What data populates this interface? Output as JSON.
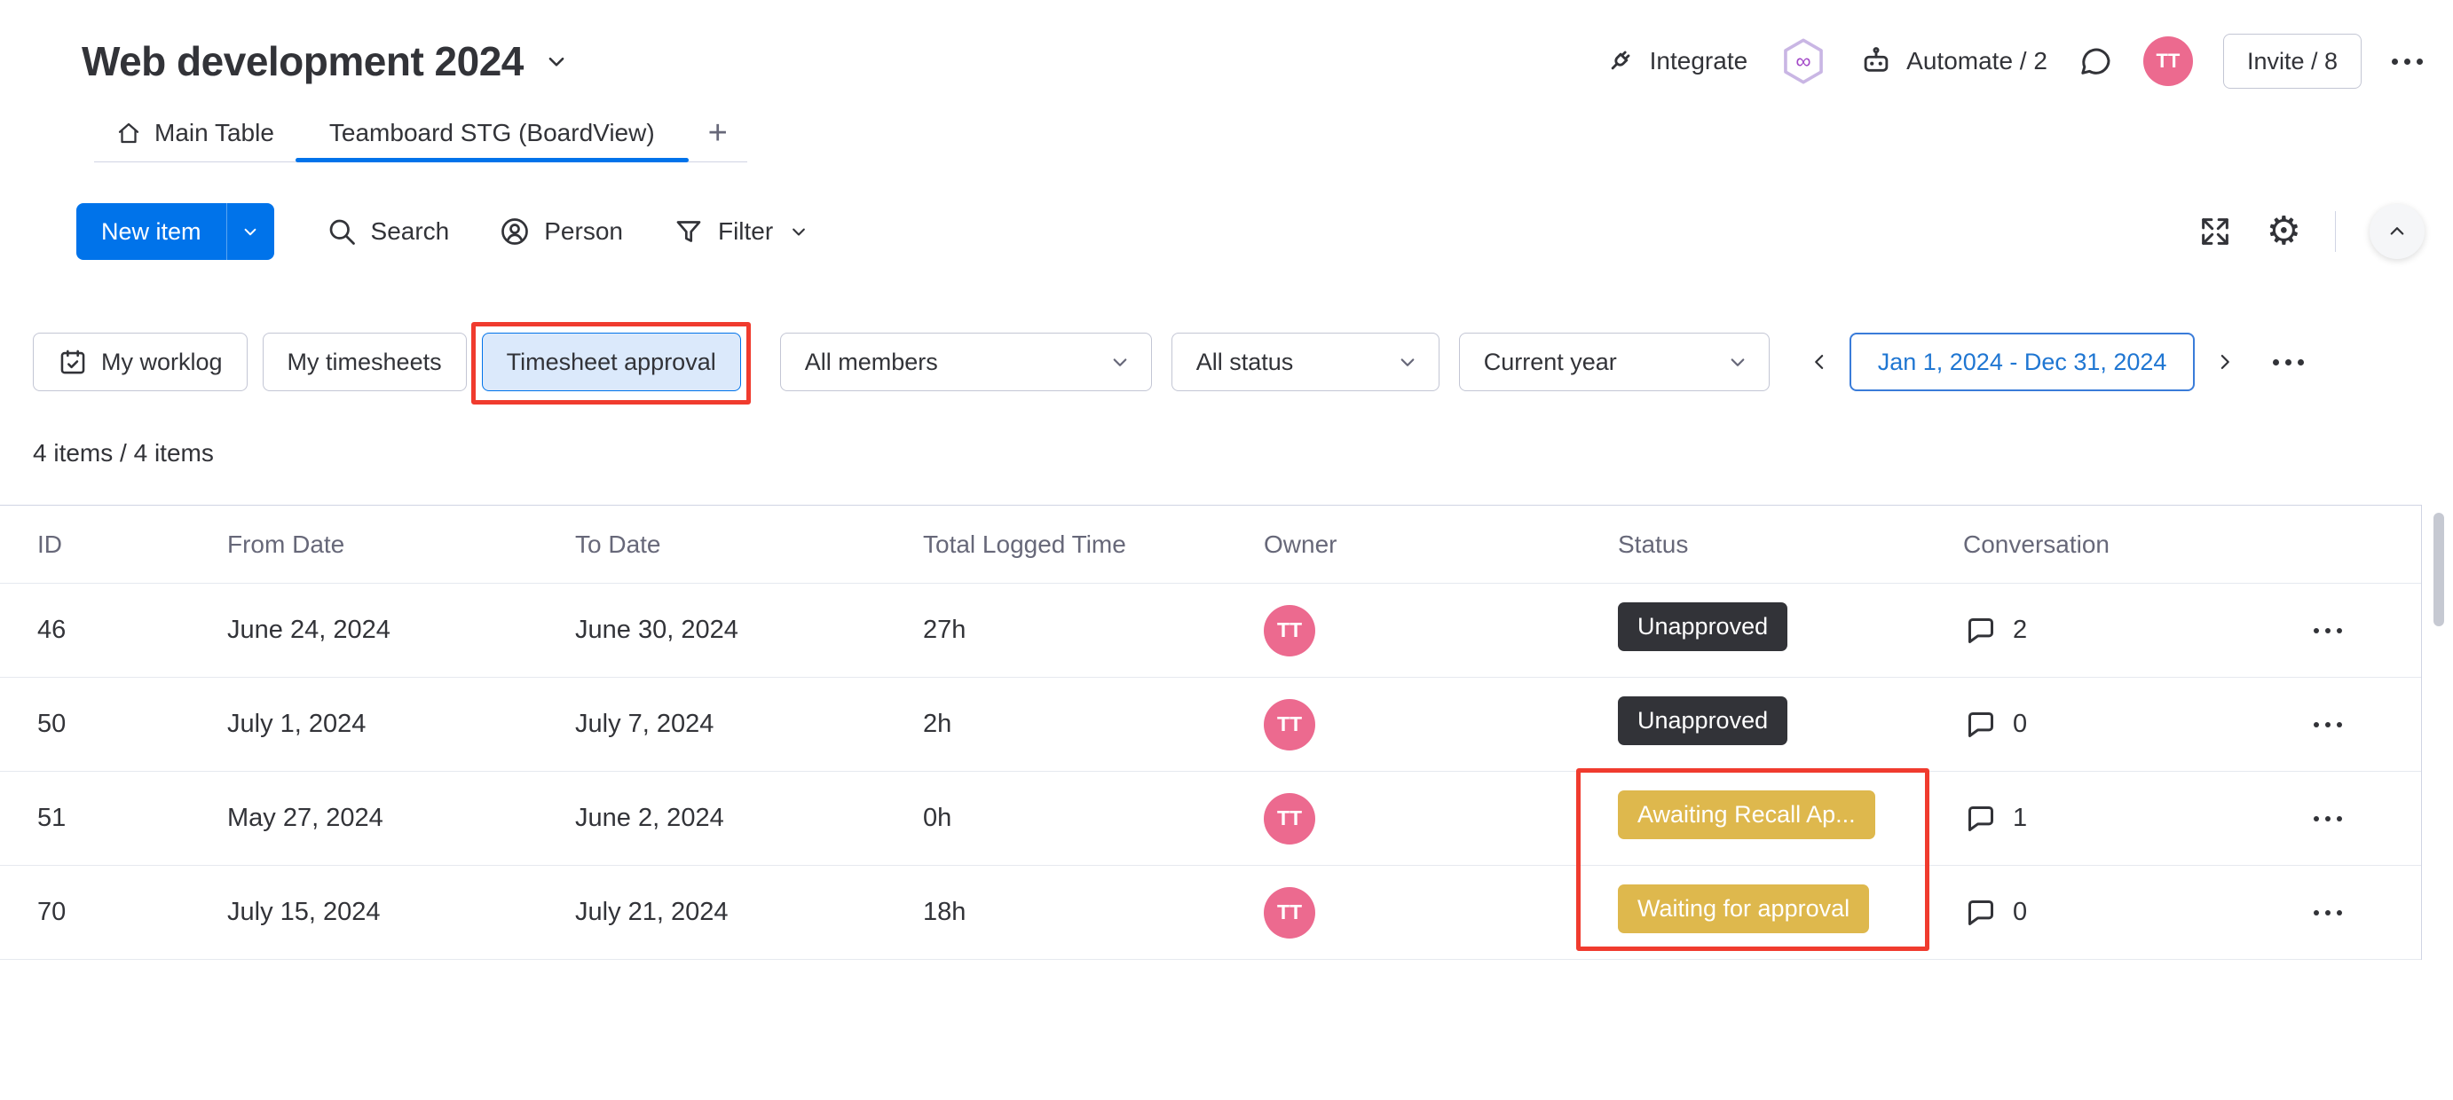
{
  "board": {
    "title": "Web development 2024"
  },
  "header": {
    "integrate_label": "Integrate",
    "automate_label": "Automate / 2",
    "invite_label": "Invite / 8",
    "avatar_initials": "TT"
  },
  "tabs": {
    "main_table": "Main Table",
    "board_view": "Teamboard STG (BoardView)",
    "add_tab": "+"
  },
  "toolbar": {
    "new_item": "New item",
    "search": "Search",
    "person": "Person",
    "filter": "Filter"
  },
  "filters": {
    "my_worklog": "My worklog",
    "my_timesheets": "My timesheets",
    "timesheet_approval": "Timesheet approval",
    "members": "All members",
    "status": "All status",
    "period": "Current year",
    "date_range": "Jan 1, 2024 - Dec 31, 2024"
  },
  "summary": {
    "items_count": "4 items / 4 items"
  },
  "table": {
    "columns": [
      "ID",
      "From Date",
      "To Date",
      "Total Logged Time",
      "Owner",
      "Status",
      "Conversation"
    ],
    "rows": [
      {
        "id": "46",
        "from_date": "June 24, 2024",
        "to_date": "June 30, 2024",
        "total_time": "27h",
        "owner": "TT",
        "status": "Unapproved",
        "conversations": "2"
      },
      {
        "id": "50",
        "from_date": "July 1, 2024",
        "to_date": "July 7, 2024",
        "total_time": "2h",
        "owner": "TT",
        "status": "Unapproved",
        "conversations": "0"
      },
      {
        "id": "51",
        "from_date": "May 27, 2024",
        "to_date": "June 2, 2024",
        "total_time": "0h",
        "owner": "TT",
        "status": "Awaiting Recall Ap...",
        "conversations": "1"
      },
      {
        "id": "70",
        "from_date": "July 15, 2024",
        "to_date": "July 21, 2024",
        "total_time": "18h",
        "owner": "TT",
        "status": "Waiting for approval",
        "conversations": "0"
      }
    ]
  },
  "icons": {
    "gear": "⚙",
    "infinity": "∞"
  },
  "colors": {
    "primary_blue": "#0073ea",
    "dark_badge": "#323338",
    "yellow_badge": "#deb84d",
    "avatar_pink": "#ec6a8f",
    "annotation_red": "#f03b2e",
    "selected_chip_bg": "#dbe9fb"
  }
}
